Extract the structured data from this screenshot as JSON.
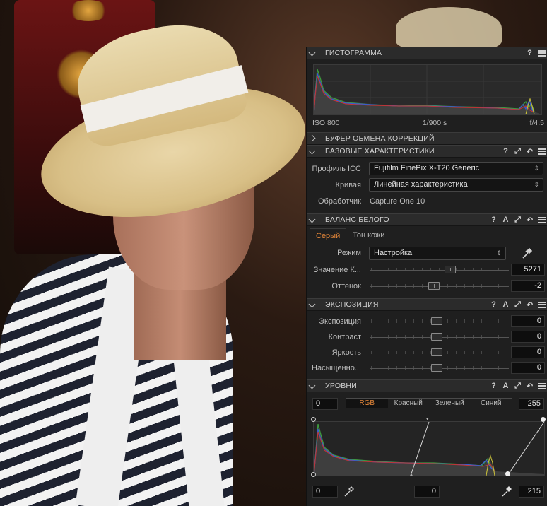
{
  "histogram": {
    "title": "ГИСТОГРАММА",
    "iso": "ISO 800",
    "shutter": "1/900 s",
    "aperture": "f/4.5"
  },
  "clipboard": {
    "title": "БУФЕР ОБМЕНА КОРРЕКЦИЙ"
  },
  "base": {
    "title": "БАЗОВЫЕ ХАРАКТЕРИСТИКИ",
    "icc_label": "Профиль ICC",
    "icc_value": "Fujifilm FinePix X-T20 Generic",
    "curve_label": "Кривая",
    "curve_value": "Линейная характеристика",
    "engine_label": "Обработчик",
    "engine_value": "Capture One 10"
  },
  "wb": {
    "title": "БАЛАНС БЕЛОГО",
    "tabs": [
      "Серый",
      "Тон кожи"
    ],
    "mode_label": "Режим",
    "mode_value": "Настройка",
    "kelvin_label": "Значение К...",
    "kelvin_value": "5271",
    "tint_label": "Оттенок",
    "tint_value": "-2"
  },
  "exposure": {
    "title": "ЭКСПОЗИЦИЯ",
    "rows": [
      {
        "label": "Экспозиция",
        "value": "0"
      },
      {
        "label": "Контраст",
        "value": "0"
      },
      {
        "label": "Яркость",
        "value": "0"
      },
      {
        "label": "Насыщенно...",
        "value": "0"
      }
    ]
  },
  "levels": {
    "title": "УРОВНИ",
    "input_low": "0",
    "input_high": "255",
    "channels": [
      "RGB",
      "Красный",
      "Зеленый",
      "Синий"
    ],
    "selected_channel": "RGB",
    "output_low": "0",
    "midpoint": "0",
    "output_high": "215"
  },
  "header_icons": {
    "help": "?",
    "auto": "A"
  },
  "colors": {
    "accent": "#e8893a",
    "panel_bg": "#1f1f1f",
    "header_bg": "#2b2b2b"
  }
}
